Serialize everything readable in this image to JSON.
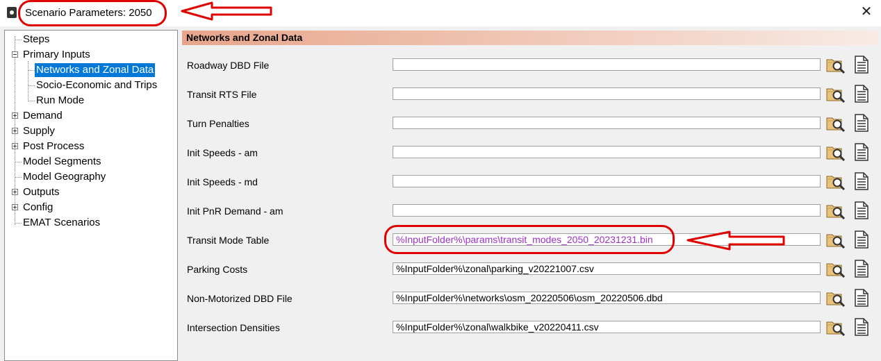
{
  "window": {
    "title": "Scenario Parameters: 2050",
    "close_symbol": "✕"
  },
  "tree": [
    {
      "label": "Steps"
    },
    {
      "label": "Primary Inputs"
    },
    {
      "label": "Networks and Zonal Data"
    },
    {
      "label": "Socio-Economic and Trips"
    },
    {
      "label": "Run Mode"
    },
    {
      "label": "Demand"
    },
    {
      "label": "Supply"
    },
    {
      "label": "Post Process"
    },
    {
      "label": "Model Segments"
    },
    {
      "label": "Model Geography"
    },
    {
      "label": "Outputs"
    },
    {
      "label": "Config"
    },
    {
      "label": "EMAT Scenarios"
    }
  ],
  "section": {
    "title": "Networks and Zonal Data"
  },
  "fields": [
    {
      "label": "Roadway DBD File",
      "value": ""
    },
    {
      "label": "Transit RTS File",
      "value": ""
    },
    {
      "label": "Turn Penalties",
      "value": ""
    },
    {
      "label": "Init Speeds - am",
      "value": ""
    },
    {
      "label": "Init Speeds - md",
      "value": ""
    },
    {
      "label": "Init PnR Demand - am",
      "value": ""
    },
    {
      "label": "Transit Mode Table",
      "value": "%InputFolder%\\params\\transit_modes_2050_20231231.bin"
    },
    {
      "label": "Parking Costs",
      "value": "%InputFolder%\\zonal\\parking_v20221007.csv"
    },
    {
      "label": "Non-Motorized DBD File",
      "value": "%InputFolder%\\networks\\osm_20220506\\osm_20220506.dbd"
    },
    {
      "label": "Intersection Densities",
      "value": "%InputFolder%\\zonal\\walkbike_v20220411.csv"
    }
  ],
  "icons": {
    "browse": "folder-search-icon",
    "document": "document-icon",
    "app": "settings-app-icon"
  },
  "colors": {
    "selection": "#0078d7",
    "highlight_text": "#9b30c8",
    "annotation": "#e00000",
    "header_start": "#e8a58b"
  }
}
